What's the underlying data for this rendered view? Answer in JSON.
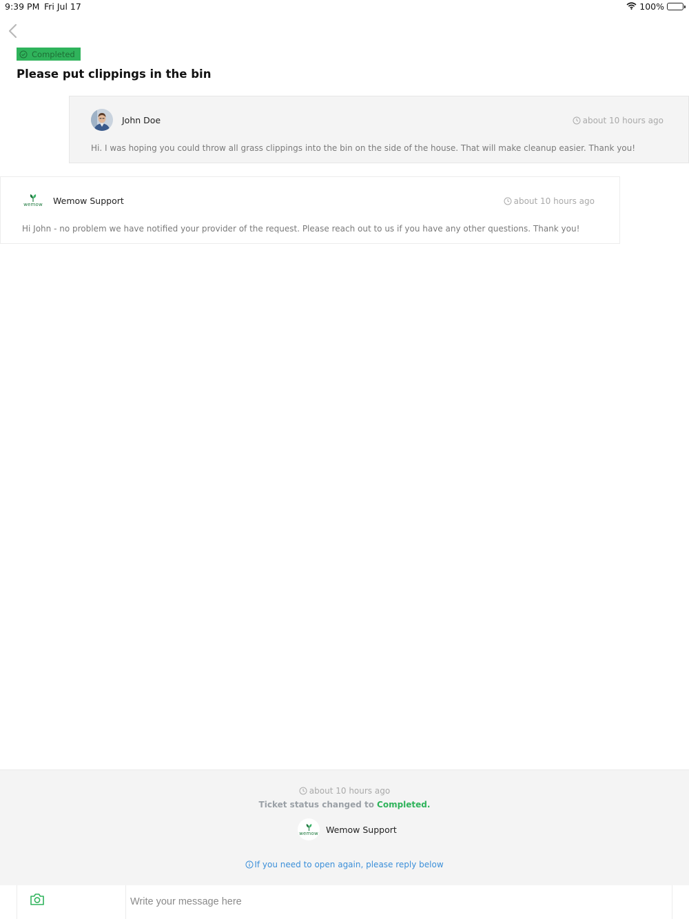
{
  "status_bar": {
    "time": "9:39 PM",
    "date": "Fri Jul 17",
    "battery": "100%"
  },
  "ticket": {
    "status": "Completed",
    "title": "Please put clippings in the bin"
  },
  "messages": [
    {
      "author": "John Doe",
      "time": "about 10 hours ago",
      "body": "Hi. I was hoping you could throw all grass clippings into the bin on the side of the house. That will make cleanup easier. Thank you!"
    },
    {
      "author": "Wemow Support",
      "time": "about 10 hours ago",
      "body": "Hi John - no problem we have notified your provider of the request.  Please reach out to us if you have any other questions. Thank you!"
    }
  ],
  "status_event": {
    "time": "about 10 hours ago",
    "label": "Ticket status changed to",
    "value": "Completed.",
    "author": "Wemow Support",
    "hint": "If you need to open again, please reply below"
  },
  "logo": {
    "word": "wemow"
  },
  "composer": {
    "placeholder": "Write your message here"
  },
  "colors": {
    "accent_green": "#2fb35b",
    "link_blue": "#3b8fd9",
    "muted_gray": "#a9a9a9"
  },
  "icons": {
    "back": "chevron-left-icon",
    "status": "check-circle-icon",
    "time": "clock-icon",
    "info": "info-circle-icon",
    "attach": "camera-icon",
    "wifi": "wifi-icon",
    "battery": "battery-icon"
  }
}
